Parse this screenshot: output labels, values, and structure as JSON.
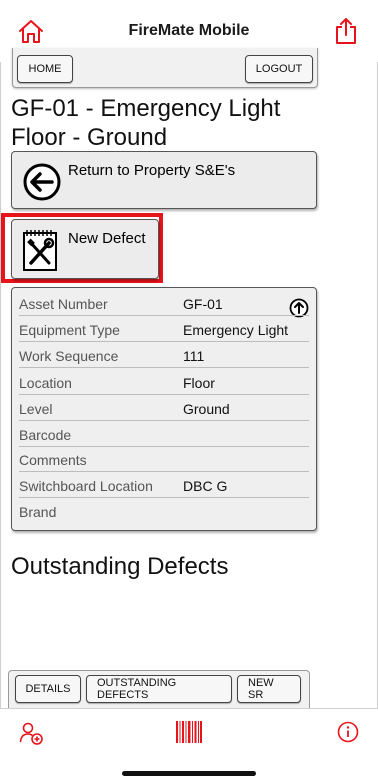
{
  "app": {
    "title": "FireMate Mobile"
  },
  "nav": {
    "home_label": "HOME",
    "logout_label": "LOGOUT"
  },
  "page": {
    "heading": "GF-01 - Emergency Light Floor - Ground"
  },
  "actions": {
    "return_label": "Return to Property S&E's",
    "new_defect_label": "New Defect"
  },
  "asset": {
    "rows": [
      {
        "key": "Asset Number",
        "value": "GF-01"
      },
      {
        "key": "Equipment Type",
        "value": "Emergency Light"
      },
      {
        "key": "Work Sequence",
        "value": "111"
      },
      {
        "key": "Location",
        "value": "Floor"
      },
      {
        "key": "Level",
        "value": "Ground"
      },
      {
        "key": "Barcode",
        "value": ""
      },
      {
        "key": "Comments",
        "value": ""
      },
      {
        "key": "Switchboard Location",
        "value": "DBC G"
      },
      {
        "key": "Brand",
        "value": ""
      }
    ]
  },
  "defects": {
    "title": "Outstanding Defects"
  },
  "bottom_buttons": {
    "details": "DETAILS",
    "outstanding": "OUTSTANDING DEFECTS",
    "new_sr": "NEW SR"
  },
  "colors": {
    "accent": "#e8141b",
    "panel": "#efefef"
  },
  "icons": [
    "home-icon",
    "share-icon",
    "back-arrow-icon",
    "tools-icon",
    "up-arrow-icon",
    "add-user-icon",
    "barcode-icon",
    "info-icon"
  ]
}
